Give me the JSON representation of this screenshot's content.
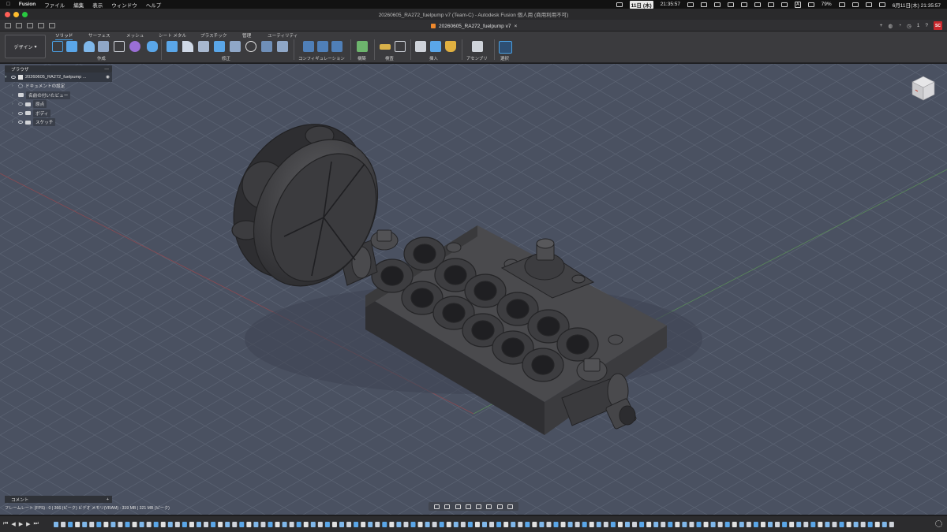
{
  "menubar": {
    "app_name": "Fusion",
    "items": [
      "ファイル",
      "編集",
      "表示",
      "ウィンドウ",
      "ヘルプ"
    ],
    "date_badge": "11日 (木)",
    "clock_short": "21:35:57",
    "battery": "79%",
    "input_mode": "A",
    "datetime": "6月11日(木) 21:35:57"
  },
  "window": {
    "title": "20260605_RA272_fuelpump v7 (Team-C) - Autodesk Fusion 個人用 (商用利用不可)"
  },
  "tabbar": {
    "doc_tab": "20260605_RA272_fuelpump v7",
    "user_count": "1",
    "user_initials": "SC"
  },
  "ribbon": {
    "workspace": "デザイン",
    "tabs": [
      "ソリッド",
      "サーフェス",
      "メッシュ",
      "シート メタル",
      "プラスチック",
      "管理",
      "ユーティリティ"
    ],
    "groups": [
      "作成",
      "修正",
      "コンフィギュレーション",
      "構築",
      "検査",
      "挿入",
      "アセンブリ",
      "選択"
    ]
  },
  "browser": {
    "title": "ブラウザ",
    "root": "20260605_RA272_fuelpump ...",
    "items": [
      "ドキュメントの設定",
      "名前の付いたビュー",
      "原点",
      "ボディ",
      "スケッチ"
    ]
  },
  "comments": {
    "title": "コメント"
  },
  "status": {
    "text": "フレームレート (FPS) : 0 | 366 (ピーク) ビデオ メモリ(VRAM) : 319 MB | 321 MB (ピーク)"
  },
  "colors": {
    "canvas": "#4a5161",
    "grid": "#5a6272",
    "accent": "#4a9ee0",
    "avatar": "#c8282d",
    "model": "#3a3a3c"
  }
}
